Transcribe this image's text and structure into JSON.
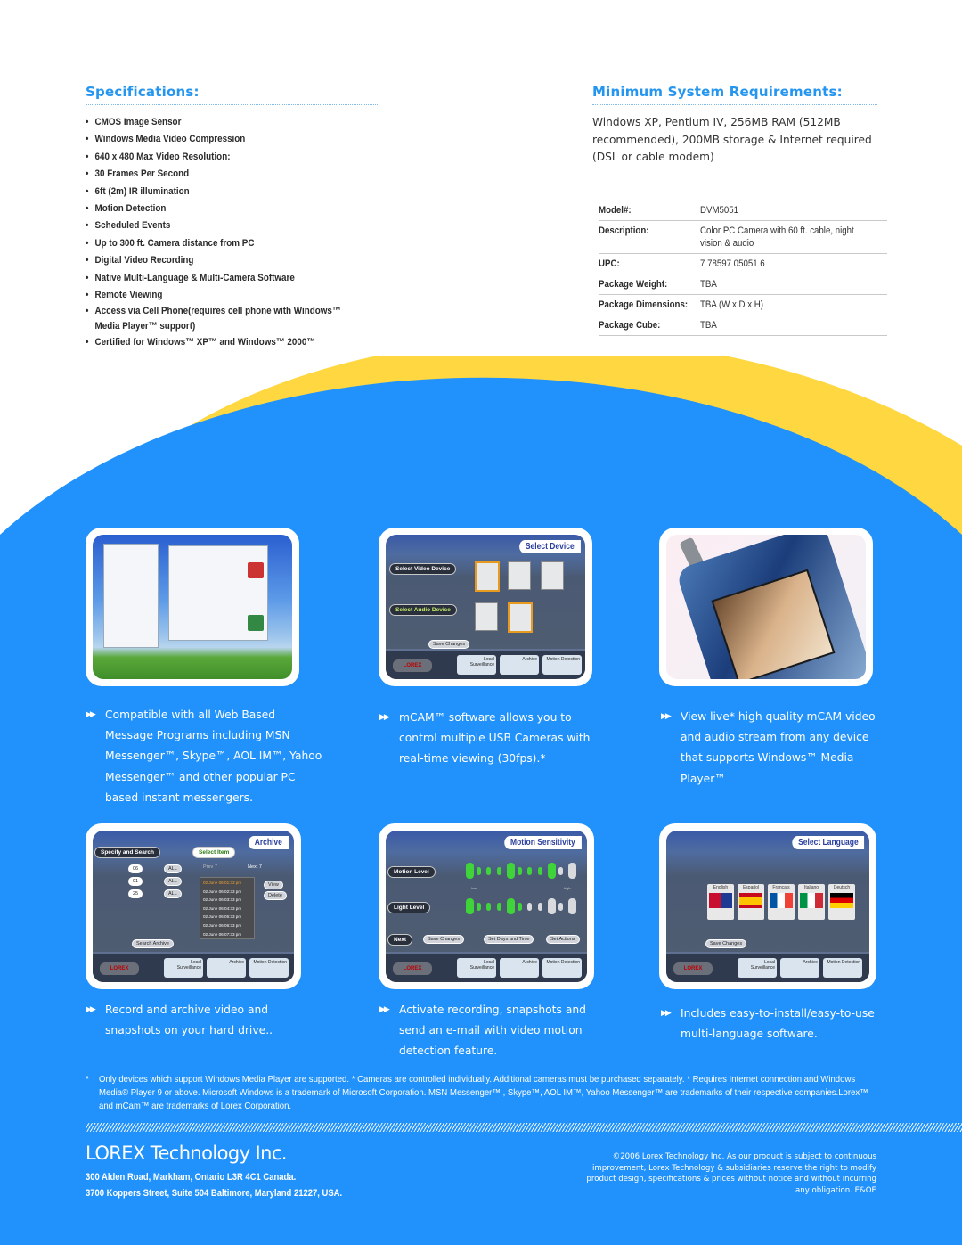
{
  "specifications": {
    "title": "Specifications:",
    "bullet": "•",
    "items": [
      "CMOS Image Sensor",
      "Windows Media Video Compression",
      "640 x 480  Max Video Resolution:",
      "30 Frames Per Second",
      "6ft (2m) IR illumination",
      "Motion Detection",
      "Scheduled Events",
      "Up to 300 ft. Camera distance from PC",
      "Digital Video Recording",
      "Native Multi-Language & Multi-Camera Software",
      "Remote Viewing",
      "Access via Cell Phone(requires cell phone with Windows™ Media Player™ support)",
      "Certified for Windows™ XP™ and Windows™ 2000™"
    ]
  },
  "requirements": {
    "title": "Minimum System Requirements:",
    "text": "Windows XP, Pentium IV, 256MB RAM (512MB recommended), 200MB storage & Internet required (DSL or cable modem)"
  },
  "product_table": [
    {
      "key": "Model#:",
      "value": "DVM5051"
    },
    {
      "key": "Description:",
      "value": "Color PC Camera with 60 ft. cable, night vision & audio"
    },
    {
      "key": "UPC:",
      "value": "7 78597 05051 6"
    },
    {
      "key": "Package Weight:",
      "value": "TBA"
    },
    {
      "key": "Package Dimensions:",
      "value": "TBA (W x D x H)"
    },
    {
      "key": "Package Cube:",
      "value": "TBA"
    }
  ],
  "colors": {
    "accent_blue": "#2596f0",
    "panel_blue": "#2192fb",
    "arc_yellow": "#ffd740"
  },
  "features": {
    "arrow_icon": "▶▶",
    "items": [
      "Compatible with all Web Based Message Programs including MSN Messenger™, Skype™, AOL IM™, Yahoo Messenger™ and other popular PC based instant messengers.",
      "mCAM™ software allows you to control multiple USB Cameras with real-time viewing (30fps).*",
      "View live* high quality mCAM video and audio stream from any device that supports Windows™ Media Player™",
      "Record and archive video and snapshots on your hard drive..",
      "Activate recording, snapshots and send an e-mail with video motion detection feature.",
      "Includes easy-to-install/easy-to-use multi-language software."
    ]
  },
  "screens": {
    "select_device": {
      "title": "Select Device",
      "video_label": "Select Video Device",
      "audio_label": "Select Audio Device",
      "save": "Save Changes"
    },
    "archive": {
      "title": "Archive",
      "step1": "Specify and Search",
      "step2": "Select Item",
      "year": "06",
      "month": "01",
      "day": "25",
      "all": "ALL",
      "prev": "Prev 7",
      "next": "Next 7",
      "entries": [
        "02 June 06  01:33 pm",
        "02 June 06  02:33 pm",
        "02 June 06  03:33 pm",
        "02 June 06  04:33 pm",
        "02 June 06  05:33 pm",
        "02 June 06  06:33 pm",
        "02 June 06  07:33 pm"
      ],
      "view": "View",
      "delete": "Delete",
      "search": "Search Archive"
    },
    "motion": {
      "title": "Motion Sensitivity",
      "motion_level": "Motion Level",
      "light_level": "Light Level",
      "next": "Next",
      "low": "low",
      "high": "high",
      "save": "Save Changes",
      "set_days": "Set Days and Time",
      "set_actions": "Set Actions"
    },
    "language": {
      "title": "Select Language",
      "languages": [
        "English",
        "Español",
        "Français",
        "Italiano",
        "Deutsch"
      ],
      "save": "Save Changes"
    },
    "nav": {
      "logo": "LOREX",
      "buttons": [
        "Local Surveillance",
        "Archive",
        "Motion Detection"
      ]
    }
  },
  "footnote": {
    "star": "*",
    "text": "Only devices which support Windows Media Player are supported. * Cameras are controlled individually. Additional cameras must be purchased separately. * Requires Internet connection and Windows Media® Player 9 or above. Microsoft Windows is a trademark of Microsoft Corporation. MSN Messenger™ , Skype™, AOL IM™, Yahoo Messenger™ are trademarks of their respective companies.Lorex™ and mCam™ are trademarks of Lorex Corporation."
  },
  "footer": {
    "company": "LOREX Technology Inc.",
    "address_canada": "300 Alden Road, Markham, Ontario L3R 4C1 Canada.",
    "address_usa": "3700 Koppers Street, Suite 504 Baltimore, Maryland 21227, USA.",
    "copyright": "©2006 Lorex Technology Inc. As our product is subject to continuous improvement, Lorex Technology & subsidiaries reserve the right to modify product design, specifications & prices without notice and without incurring any obligation. E&OE"
  }
}
